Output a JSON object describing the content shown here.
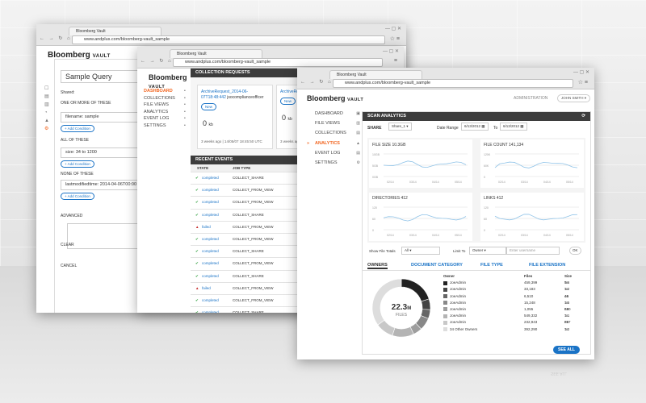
{
  "browser": {
    "tab_title": "Bloomberg Vault",
    "url": "www.andplus.com/bloomberg-vault_sample"
  },
  "brand": {
    "name": "Bloomberg",
    "suffix": "VAULT"
  },
  "window1": {
    "title": "Sample Query",
    "shared_label": "Shared:",
    "section_one": "ONE OR MORE OF THESE",
    "filter_one": "filename: sample",
    "add_condition": "Add Condition",
    "section_all": "ALL OF THESE",
    "filter_all": "size: 34 to 1200",
    "section_none": "NONE OF THESE",
    "filter_none": "lastmodifiedtime: 2014-04-06T00:00",
    "advanced": "ADVANCED",
    "clear": "CLEAR",
    "cancel": "CANCEL"
  },
  "window2": {
    "nav": [
      {
        "label": "DASHBOARD",
        "active": true
      },
      {
        "label": "COLLECTIONS",
        "active": false
      },
      {
        "label": "FILE VIEWS",
        "active": false
      },
      {
        "label": "ANALYTICS",
        "active": false
      },
      {
        "label": "EVENT LOG",
        "active": false
      },
      {
        "label": "SETTINGS",
        "active": false
      }
    ],
    "collection_requests_title": "COLLECTION REQUESTS",
    "requests": [
      {
        "title": "ArchiveRequest_2014-06-07T18:48:442",
        "owner": "jsocomplianceofficer",
        "link": "New",
        "count": "0",
        "unit": "kb",
        "footer": "3 weeks ago  |  14/05/07 18:45:50 UTC"
      },
      {
        "title": "ArchiveRequ... 07T18:48:44",
        "owner": "",
        "link": "New",
        "count": "0",
        "unit": "kb",
        "footer": "3 weeks ago"
      }
    ],
    "recent_events_title": "RECENT EVENTS",
    "columns": {
      "state": "STATE",
      "job_type": "JOB TYPE"
    },
    "events": [
      {
        "state": "completed",
        "job": "COLLECT_SHARE",
        "ok": true
      },
      {
        "state": "completed",
        "job": "COLLECT_FROM_VIEW",
        "ok": true
      },
      {
        "state": "completed",
        "job": "COLLECT_FROM_VIEW",
        "ok": true
      },
      {
        "state": "completed",
        "job": "COLLECT_SHARE",
        "ok": true
      },
      {
        "state": "failed",
        "job": "COLLECT_FROM_VIEW",
        "ok": false
      },
      {
        "state": "completed",
        "job": "COLLECT_FROM_VIEW",
        "ok": true
      },
      {
        "state": "completed",
        "job": "COLLECT_SHARE",
        "ok": true
      },
      {
        "state": "completed",
        "job": "COLLECT_FROM_VIEW",
        "ok": true
      },
      {
        "state": "completed",
        "job": "COLLECT_SHARE",
        "ok": true
      },
      {
        "state": "failed",
        "job": "COLLECT_FROM_VIEW",
        "ok": false
      },
      {
        "state": "completed",
        "job": "COLLECT_FROM_VIEW",
        "ok": true
      },
      {
        "state": "completed",
        "job": "COLLECT_SHARE",
        "ok": true
      },
      {
        "state": "completed",
        "job": "COLLECT_FROM_VIEW",
        "ok": true
      },
      {
        "state": "completed",
        "job": "COLLECT_FROM_VIEW",
        "ok": true
      }
    ]
  },
  "window3": {
    "administration": "ADMINISTRATION",
    "user": "JOHN SMITH",
    "nav": [
      {
        "label": "DASHBOARD",
        "active": false
      },
      {
        "label": "FILE VIEWS",
        "active": false
      },
      {
        "label": "COLLECTIONS",
        "active": false
      },
      {
        "label": "ANALYTICS",
        "active": true
      },
      {
        "label": "EVENT LOG",
        "active": false
      },
      {
        "label": "SETTINGS",
        "active": false
      }
    ],
    "scan_analytics_title": "SCAN ANALYTICS",
    "share_label": "SHARE",
    "share_value": "Share_1",
    "date_range_label": "Date Range",
    "date_from": "6/13/2012",
    "to_label": "To",
    "date_to": "6/13/2012",
    "metrics": [
      {
        "label": "FILE SIZE",
        "value": "10.3GB",
        "y_ticks": [
          "10GB",
          "5GB",
          "0GB"
        ],
        "x_ticks": [
          "02/14",
          "03/14",
          "04/14",
          "05/14"
        ]
      },
      {
        "label": "FILE COUNT",
        "value": "141,134",
        "y_ticks": [
          "120K",
          "60K",
          "0"
        ],
        "x_ticks": [
          "02/14",
          "03/14",
          "04/14",
          "05/14"
        ]
      },
      {
        "label": "DIRECTORIES",
        "value": "412",
        "y_ticks": [
          "120",
          "60",
          "0"
        ],
        "x_ticks": [
          "02/14",
          "03/14",
          "04/14",
          "05/14"
        ]
      },
      {
        "label": "LINKS",
        "value": "412",
        "y_ticks": [
          "120",
          "60",
          "0"
        ],
        "x_ticks": [
          "02/14",
          "03/14",
          "04/14",
          "05/14"
        ]
      }
    ],
    "show_file_totals_label": "Show File Totals",
    "show_file_totals_value": "All",
    "limit_to_label": "Limit To",
    "limit_to_value": "Owner",
    "username_placeholder": "Enter username",
    "ok_label": "OK",
    "tabs": [
      "OWNERS",
      "DOCUMENT CATEGORY",
      "FILE TYPE",
      "FILE EXTENSION"
    ],
    "donut_value": "22.3",
    "donut_unit": "M",
    "donut_label": "FILES",
    "owner_columns": {
      "owner": "Owner",
      "files": "Files",
      "size": "Size"
    },
    "owners": [
      {
        "name": "JoeAdmin",
        "files": "459,399",
        "size": "5.6",
        "unit": "TB",
        "shade": "#222222",
        "share": 0.2
      },
      {
        "name": "JoeAdmin",
        "files": "33,183",
        "size": "1.2",
        "unit": "TB",
        "shade": "#444444",
        "share": 0.06
      },
      {
        "name": "JoeAdmin",
        "files": "6,510",
        "size": "46",
        "unit": "GB",
        "shade": "#666666",
        "share": 0.05
      },
      {
        "name": "JoeAdmin",
        "files": "15,248",
        "size": "1.5",
        "unit": "TB",
        "shade": "#888888",
        "share": 0.07
      },
      {
        "name": "JoeAdmin",
        "files": "1,055",
        "size": "530",
        "unit": "GB",
        "shade": "#9e9e9e",
        "share": 0.05
      },
      {
        "name": "JoeAdmin",
        "files": "549,332",
        "size": "1.1",
        "unit": "TB",
        "shade": "#b4b4b4",
        "share": 0.12
      },
      {
        "name": "JoeAdmin",
        "files": "232,943",
        "size": "897",
        "unit": "GB",
        "shade": "#c8c8c8",
        "share": 0.1
      },
      {
        "name": "34 Other Owners",
        "files": "392,290",
        "size": "1.2",
        "unit": "TB",
        "shade": "#dddddd",
        "share": 0.35
      }
    ],
    "see_all": "SEE ALL",
    "reflection": "SEE ALL"
  },
  "colors": {
    "accent": "#f26722",
    "link": "#1a73c6",
    "dark_bar": "#3c3c3c",
    "success": "#2e9e3c",
    "failure": "#c62828"
  },
  "icons": [
    "back-icon",
    "forward-icon",
    "reload-icon",
    "home-icon",
    "star-icon",
    "menu-icon",
    "plus-icon",
    "checkmark-icon",
    "warning-icon",
    "calendar-icon",
    "chevron-down-icon",
    "gear-icon",
    "refresh-icon"
  ]
}
